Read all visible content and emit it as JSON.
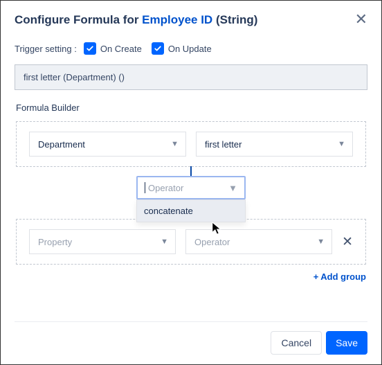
{
  "header": {
    "prefix": "Configure Formula for ",
    "link": "Employee ID",
    "suffix": " (String)"
  },
  "trigger": {
    "label": "Trigger setting :",
    "onCreate": "On Create",
    "onUpdate": "On Update"
  },
  "formulaDisplay": "first letter (Department) ()",
  "builder": {
    "label": "Formula Builder",
    "group1": {
      "property": "Department",
      "operator": "first letter"
    },
    "centerOperator": {
      "placeholder": "Operator",
      "options": [
        "concatenate"
      ]
    },
    "group2": {
      "propertyPlaceholder": "Property",
      "operatorPlaceholder": "Operator"
    },
    "addGroup": "Add group"
  },
  "footer": {
    "cancel": "Cancel",
    "save": "Save"
  }
}
